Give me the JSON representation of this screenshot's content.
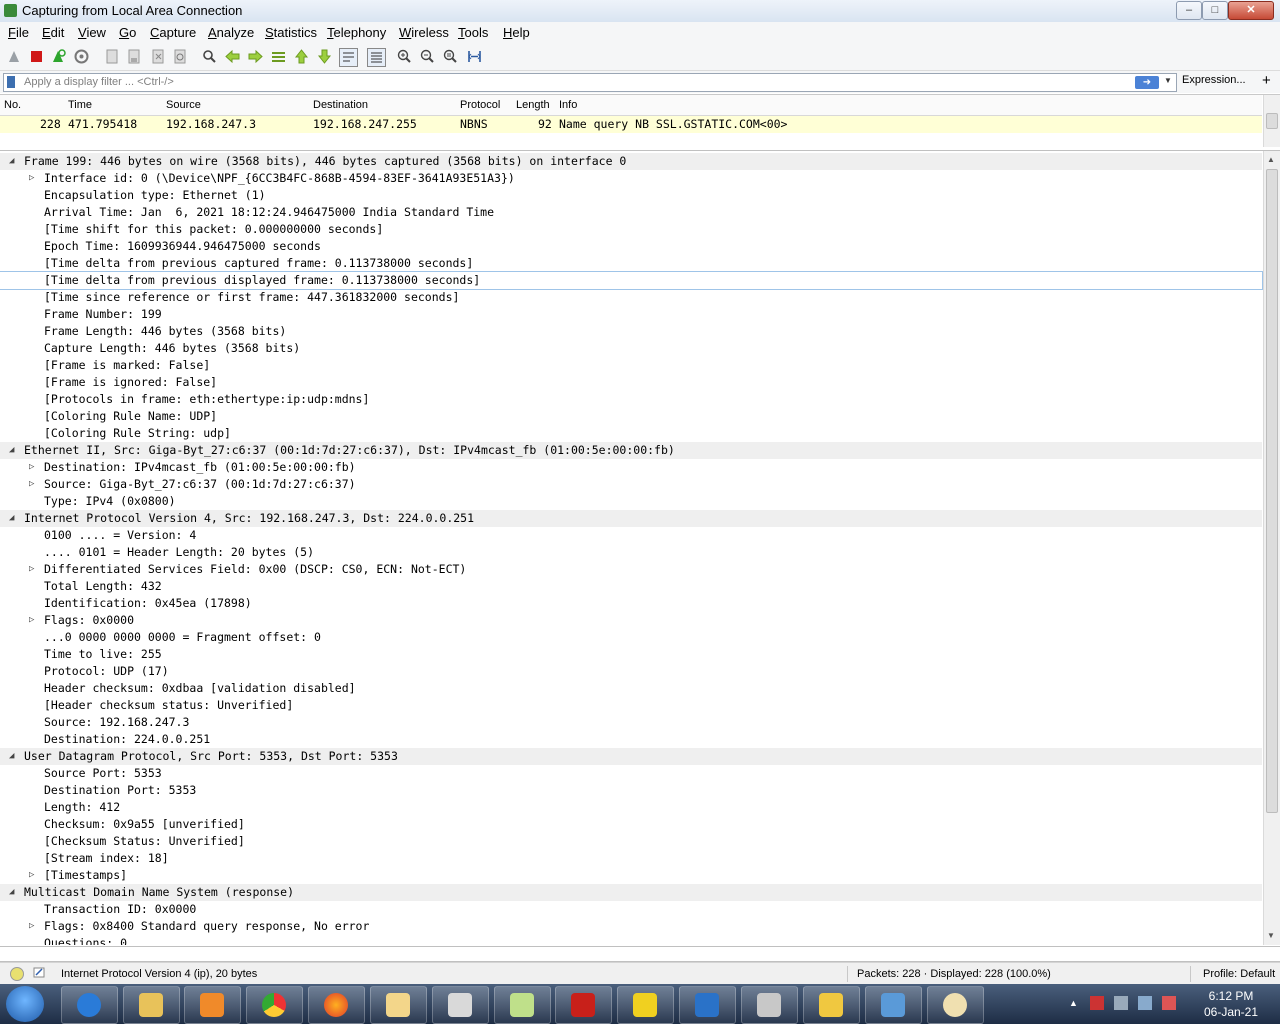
{
  "window": {
    "title": "Capturing from Local Area Connection"
  },
  "menu": [
    "File",
    "Edit",
    "View",
    "Go",
    "Capture",
    "Analyze",
    "Statistics",
    "Telephony",
    "Wireless",
    "Tools",
    "Help"
  ],
  "filter": {
    "placeholder": "Apply a display filter ... <Ctrl-/>",
    "expression_label": "Expression...",
    "plus": "+"
  },
  "packet_list": {
    "columns": [
      "No.",
      "Time",
      "Source",
      "Destination",
      "Protocol",
      "Length",
      "Info"
    ],
    "rows": [
      {
        "no": "228",
        "time": "471.795418",
        "source": "192.168.247.3",
        "destination": "192.168.247.255",
        "protocol": "NBNS",
        "length": "92",
        "info": "Name query NB SSL.GSTATIC.COM<00>"
      }
    ]
  },
  "details": [
    {
      "text": "Frame 199: 446 bytes on wire (3568 bits), 446 bytes captured (3568 bits) on interface 0",
      "level": 0,
      "expander": "open"
    },
    {
      "text": "Interface id: 0 (\\Device\\NPF_{6CC3B4FC-868B-4594-83EF-3641A93E51A3})",
      "level": 1,
      "expander": "closed"
    },
    {
      "text": "Encapsulation type: Ethernet (1)",
      "level": 1,
      "expander": "none"
    },
    {
      "text": "Arrival Time: Jan  6, 2021 18:12:24.946475000 India Standard Time",
      "level": 1,
      "expander": "none"
    },
    {
      "text": "[Time shift for this packet: 0.000000000 seconds]",
      "level": 1,
      "expander": "none"
    },
    {
      "text": "Epoch Time: 1609936944.946475000 seconds",
      "level": 1,
      "expander": "none"
    },
    {
      "text": "[Time delta from previous captured frame: 0.113738000 seconds]",
      "level": 1,
      "expander": "none"
    },
    {
      "text": "[Time delta from previous displayed frame: 0.113738000 seconds]",
      "level": 1,
      "expander": "none",
      "selected": true
    },
    {
      "text": "[Time since reference or first frame: 447.361832000 seconds]",
      "level": 1,
      "expander": "none"
    },
    {
      "text": "Frame Number: 199",
      "level": 1,
      "expander": "none"
    },
    {
      "text": "Frame Length: 446 bytes (3568 bits)",
      "level": 1,
      "expander": "none"
    },
    {
      "text": "Capture Length: 446 bytes (3568 bits)",
      "level": 1,
      "expander": "none"
    },
    {
      "text": "[Frame is marked: False]",
      "level": 1,
      "expander": "none"
    },
    {
      "text": "[Frame is ignored: False]",
      "level": 1,
      "expander": "none"
    },
    {
      "text": "[Protocols in frame: eth:ethertype:ip:udp:mdns]",
      "level": 1,
      "expander": "none"
    },
    {
      "text": "[Coloring Rule Name: UDP]",
      "level": 1,
      "expander": "none"
    },
    {
      "text": "[Coloring Rule String: udp]",
      "level": 1,
      "expander": "none"
    },
    {
      "text": "Ethernet II, Src: Giga-Byt_27:c6:37 (00:1d:7d:27:c6:37), Dst: IPv4mcast_fb (01:00:5e:00:00:fb)",
      "level": 0,
      "expander": "open"
    },
    {
      "text": "Destination: IPv4mcast_fb (01:00:5e:00:00:fb)",
      "level": 1,
      "expander": "closed"
    },
    {
      "text": "Source: Giga-Byt_27:c6:37 (00:1d:7d:27:c6:37)",
      "level": 1,
      "expander": "closed"
    },
    {
      "text": "Type: IPv4 (0x0800)",
      "level": 1,
      "expander": "none"
    },
    {
      "text": "Internet Protocol Version 4, Src: 192.168.247.3, Dst: 224.0.0.251",
      "level": 0,
      "expander": "open"
    },
    {
      "text": "0100 .... = Version: 4",
      "level": 1,
      "expander": "none"
    },
    {
      "text": ".... 0101 = Header Length: 20 bytes (5)",
      "level": 1,
      "expander": "none"
    },
    {
      "text": "Differentiated Services Field: 0x00 (DSCP: CS0, ECN: Not-ECT)",
      "level": 1,
      "expander": "closed"
    },
    {
      "text": "Total Length: 432",
      "level": 1,
      "expander": "none"
    },
    {
      "text": "Identification: 0x45ea (17898)",
      "level": 1,
      "expander": "none"
    },
    {
      "text": "Flags: 0x0000",
      "level": 1,
      "expander": "closed"
    },
    {
      "text": "...0 0000 0000 0000 = Fragment offset: 0",
      "level": 1,
      "expander": "none"
    },
    {
      "text": "Time to live: 255",
      "level": 1,
      "expander": "none"
    },
    {
      "text": "Protocol: UDP (17)",
      "level": 1,
      "expander": "none"
    },
    {
      "text": "Header checksum: 0xdbaa [validation disabled]",
      "level": 1,
      "expander": "none"
    },
    {
      "text": "[Header checksum status: Unverified]",
      "level": 1,
      "expander": "none"
    },
    {
      "text": "Source: 192.168.247.3",
      "level": 1,
      "expander": "none"
    },
    {
      "text": "Destination: 224.0.0.251",
      "level": 1,
      "expander": "none"
    },
    {
      "text": "User Datagram Protocol, Src Port: 5353, Dst Port: 5353",
      "level": 0,
      "expander": "open"
    },
    {
      "text": "Source Port: 5353",
      "level": 1,
      "expander": "none"
    },
    {
      "text": "Destination Port: 5353",
      "level": 1,
      "expander": "none"
    },
    {
      "text": "Length: 412",
      "level": 1,
      "expander": "none"
    },
    {
      "text": "Checksum: 0x9a55 [unverified]",
      "level": 1,
      "expander": "none"
    },
    {
      "text": "[Checksum Status: Unverified]",
      "level": 1,
      "expander": "none"
    },
    {
      "text": "[Stream index: 18]",
      "level": 1,
      "expander": "none"
    },
    {
      "text": "[Timestamps]",
      "level": 1,
      "expander": "closed"
    },
    {
      "text": "Multicast Domain Name System (response)",
      "level": 0,
      "expander": "open"
    },
    {
      "text": "Transaction ID: 0x0000",
      "level": 1,
      "expander": "none"
    },
    {
      "text": "Flags: 0x8400 Standard query response, No error",
      "level": 1,
      "expander": "closed"
    },
    {
      "text": "Questions: 0",
      "level": 1,
      "expander": "none"
    }
  ],
  "status": {
    "field": "Internet Protocol Version 4 (ip), 20 bytes",
    "packets": "Packets: 228 · Displayed: 228 (100.0%)",
    "profile": "Profile: Default"
  },
  "taskbar": {
    "time": "6:12 PM",
    "date": "06-Jan-21",
    "apps": [
      "internet-explorer",
      "file-explorer",
      "media-player",
      "chrome",
      "firefox",
      "mail",
      "snipping-tool",
      "notepad",
      "acrobat",
      "tool-t",
      "wireshark",
      "package",
      "cheetah",
      "remote-desktop",
      "paint"
    ]
  },
  "colors": {
    "selected_packet_bg": "#ffffd6",
    "tree_header_bg": "#efefef",
    "accent": "#3d6fb0"
  }
}
